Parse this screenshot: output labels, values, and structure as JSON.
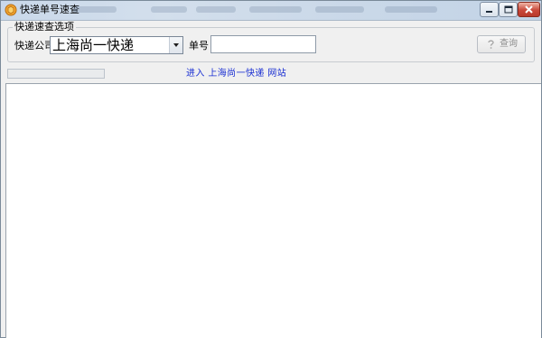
{
  "window": {
    "title": "快递单号速查"
  },
  "query_options": {
    "legend": "快递速查选项",
    "company_label": "快递公司",
    "company_selected": "上海尚一快递",
    "number_label": "单号",
    "number_value": "",
    "query_button_label": "查询"
  },
  "status": {
    "progress_fraction": 0,
    "site_link_text": "进入 上海尚一快递 网站"
  },
  "icons": {
    "app": "app-icon",
    "minimize": "minimize-icon",
    "maximize": "maximize-icon",
    "close": "close-icon",
    "dropdown": "chevron-down-icon",
    "query": "question-mark-icon"
  },
  "colors": {
    "link": "#1a2fd2",
    "disabled_text": "#8c8c8c",
    "close_button": "#c9483a"
  }
}
